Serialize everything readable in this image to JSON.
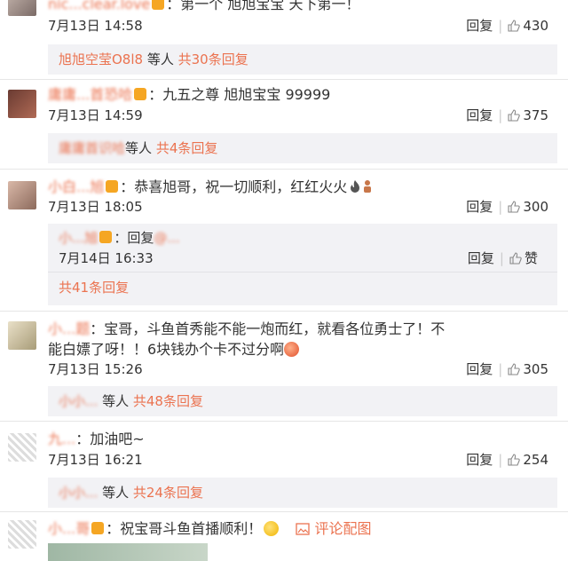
{
  "comments": [
    {
      "user": "nic...clear.love",
      "text": "：第一个 旭旭宝宝 天下第一！",
      "date": "7月13日 14:58",
      "reply": "回复",
      "likes": "430",
      "sub": {
        "user": "旭旭空莹O8l8",
        "mid": " 等人",
        "count": "共30条回复"
      }
    },
    {
      "user": "庸庸...首恐哈",
      "text": "：九五之尊 旭旭宝宝 99999",
      "date": "7月13日 14:59",
      "reply": "回复",
      "likes": "375",
      "sub": {
        "user": "庸庸首识哈",
        "mid": "等人",
        "count": "共4条回复"
      }
    },
    {
      "user": "小白...旭",
      "text": "：恭喜旭哥，祝一切顺利，红红火火",
      "date": "7月13日 18:05",
      "reply": "回复",
      "likes": "300",
      "nested": {
        "user": "小...旭",
        "text": "：回复",
        "mention": "@...",
        "date": "7月14日 16:33",
        "reply": "回复",
        "likes": "赞",
        "count": "共41条回复"
      }
    },
    {
      "user": "小...题",
      "text": "：宝哥，斗鱼首秀能不能一炮而红，就看各位勇士了！不",
      "text2": "能白嫖了呀！！6块钱办个卡不过分啊",
      "date": "7月13日 15:26",
      "reply": "回复",
      "likes": "305",
      "sub": {
        "user": "小小...",
        "mid": " 等人",
        "count": "共48条回复"
      }
    },
    {
      "user": "九...",
      "text": "：加油吧~",
      "date": "7月13日 16:21",
      "reply": "回复",
      "likes": "254",
      "sub": {
        "user": "小小...",
        "mid": " 等人",
        "count": "共24条回复"
      }
    },
    {
      "user": "小...哥",
      "text": "：祝宝哥斗鱼首播顺利！",
      "extra": "评论配图"
    }
  ]
}
